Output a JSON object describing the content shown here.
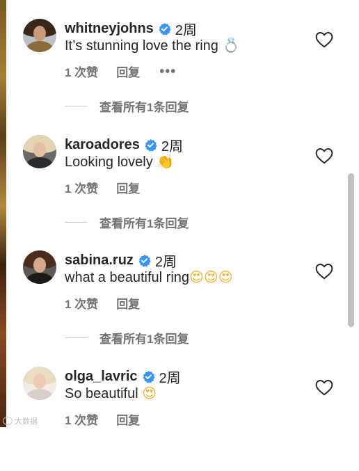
{
  "comments": [
    {
      "username": "whitneyjohns",
      "time": "2周",
      "text": "It’s stunning love the ring ",
      "emoji": "💍",
      "likes": "1 次赞",
      "reply": "回复",
      "more": "•••",
      "view_replies": "查看所有1条回复",
      "avatar_colors": {
        "hair": "#3a2718",
        "face": "#c99b7a",
        "body": "#8a6d3b",
        "bg": "#b9c2c7"
      }
    },
    {
      "username": "karoadores",
      "time": "2周",
      "text": "Looking lovely ",
      "emoji": "👏",
      "likes": "1 次赞",
      "reply": "回复",
      "view_replies": "查看所有1条回复",
      "avatar_colors": {
        "hair": "#e3d3b2",
        "face": "#e7bfa5",
        "body": "#2b2b2b",
        "bg": "#6c6a66"
      }
    },
    {
      "username": "sabina.ruz",
      "time": "2周",
      "text": "what a beautiful ring",
      "emoji": "😍😍😍",
      "likes": "1 次赞",
      "reply": "回复",
      "view_replies": "查看所有1条回复",
      "avatar_colors": {
        "hair": "#4a2d1c",
        "face": "#d7a889",
        "body": "#1f1a17",
        "bg": "#5d5955"
      }
    },
    {
      "username": "olga_lavric",
      "time": "2周",
      "text": "So beautiful ",
      "emoji": "😍",
      "likes": "1 次赞",
      "reply": "回复",
      "avatar_colors": {
        "hair": "#eadcc3",
        "face": "#eec9b3",
        "body": "#d8cfc7",
        "bg": "#f2ece6"
      }
    }
  ],
  "watermark": "大数据",
  "colors": {
    "verified": "#3797f0",
    "text": "#262626",
    "meta": "#737373",
    "heart_stroke": "#262626"
  }
}
